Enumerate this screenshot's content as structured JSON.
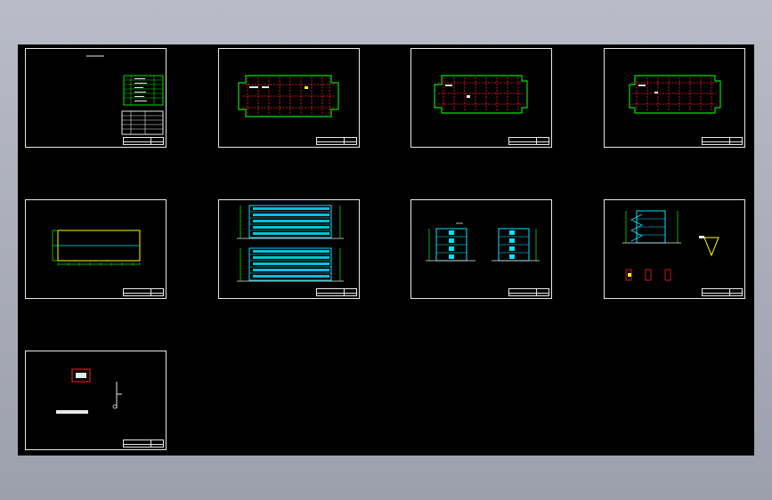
{
  "viewport": {
    "background_gradient": [
      "#b9bcc6",
      "#9c9fac"
    ],
    "canvas_color": "#000000"
  },
  "sheets": [
    {
      "id": "sheet-1",
      "content": "cover-and-tables"
    },
    {
      "id": "sheet-2",
      "content": "floor-plan"
    },
    {
      "id": "sheet-3",
      "content": "floor-plan"
    },
    {
      "id": "sheet-4",
      "content": "floor-plan"
    },
    {
      "id": "sheet-5",
      "content": "site-outline"
    },
    {
      "id": "sheet-6",
      "content": "front-elevations"
    },
    {
      "id": "sheet-7",
      "content": "side-elevations"
    },
    {
      "id": "sheet-8",
      "content": "section-and-details"
    },
    {
      "id": "sheet-9",
      "content": "details"
    }
  ],
  "colors": {
    "frame": "#e8e8e8",
    "wall": "#00e000",
    "grid": "#ff2020",
    "elevation": "#00e5ff",
    "note": "#ffff00"
  }
}
